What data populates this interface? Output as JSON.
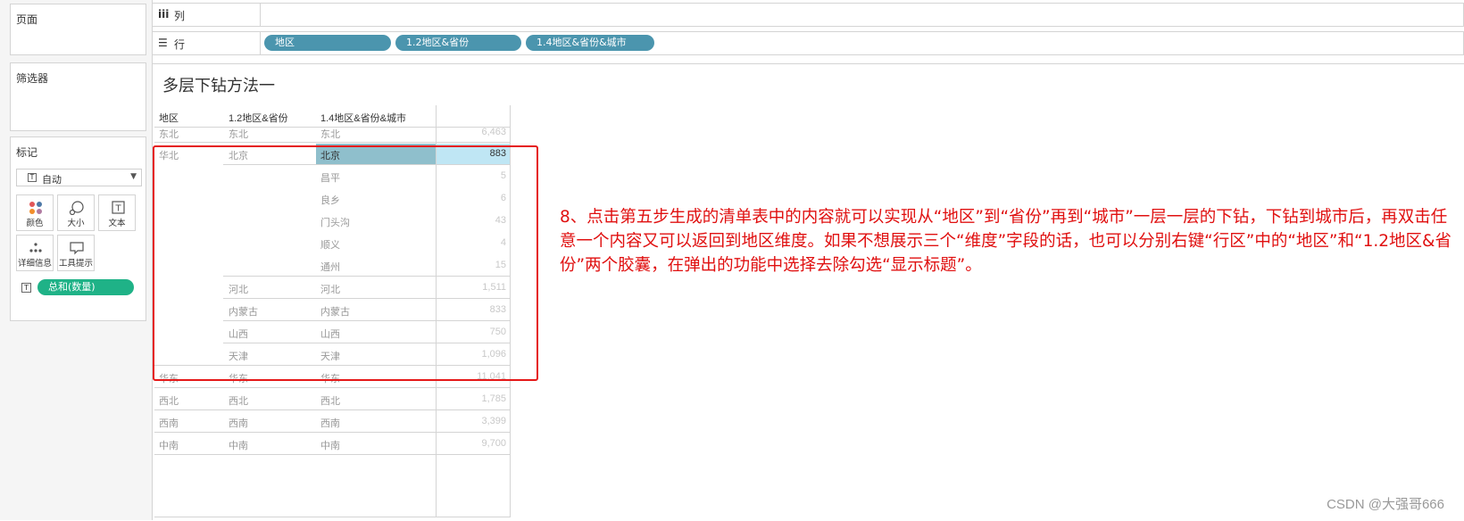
{
  "sidebar": {
    "pages_title": "页面",
    "filters_title": "筛选器",
    "marks_title": "标记",
    "mark_type": "自动",
    "mark_buttons": [
      "颜色",
      "大小",
      "文本",
      "详细信息",
      "工具提示"
    ],
    "measure_pill": "总和(数量)"
  },
  "shelves": {
    "columns_label": "列",
    "rows_label": "行",
    "row_pills": [
      "地区",
      "1.2地区&省份",
      "1.4地区&省份&城市"
    ],
    "pill_color": "#4b95ae"
  },
  "viz": {
    "title": "多层下钻方法一",
    "headers": [
      "地区",
      "1.2地区&省份",
      "1.4地区&省份&城市"
    ],
    "rows": [
      {
        "region": "东北",
        "province": "东北",
        "city": "东北",
        "value": "6,463"
      },
      {
        "region": "华北",
        "province": "北京",
        "city": "北京",
        "value": "883"
      },
      {
        "region": "",
        "province": "",
        "city": "昌平",
        "value": "5"
      },
      {
        "region": "",
        "province": "",
        "city": "良乡",
        "value": "6"
      },
      {
        "region": "",
        "province": "",
        "city": "门头沟",
        "value": "43"
      },
      {
        "region": "",
        "province": "",
        "city": "顺义",
        "value": "4"
      },
      {
        "region": "",
        "province": "",
        "city": "通州",
        "value": "15"
      },
      {
        "region": "",
        "province": "河北",
        "city": "河北",
        "value": "1,511"
      },
      {
        "region": "",
        "province": "内蒙古",
        "city": "内蒙古",
        "value": "833"
      },
      {
        "region": "",
        "province": "山西",
        "city": "山西",
        "value": "750"
      },
      {
        "region": "",
        "province": "天津",
        "city": "天津",
        "value": "1,096"
      },
      {
        "region": "华东",
        "province": "华东",
        "city": "华东",
        "value": "11,041"
      },
      {
        "region": "西北",
        "province": "西北",
        "city": "西北",
        "value": "1,785"
      },
      {
        "region": "西南",
        "province": "西南",
        "city": "西南",
        "value": "3,399"
      },
      {
        "region": "中南",
        "province": "中南",
        "city": "中南",
        "value": "9,700"
      }
    ],
    "highlight_cell_color": "#8fbfcc",
    "highlight_value_color": "#bfe6f4"
  },
  "annotation": "8、点击第五步生成的清单表中的内容就可以实现从“地区”到“省份”再到“城市”一层一层的下钻，下钻到城市后，再双击任意一个内容又可以返回到地区维度。如果不想展示三个“维度”字段的话，也可以分别右键“行区”中的“地区”和“1.2地区&省份”两个胶囊，在弹出的功能中选择去除勾选“显示标题”。",
  "annotation_color": "#e01010",
  "watermark": "CSDN @大强哥666"
}
